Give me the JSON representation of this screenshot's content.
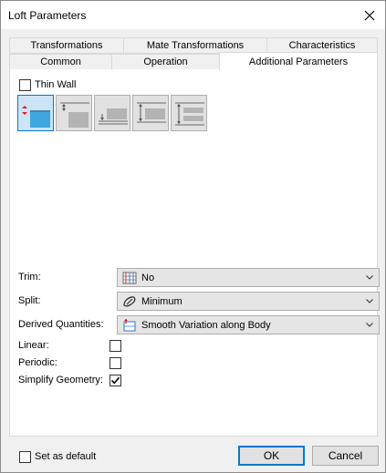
{
  "window": {
    "title": "Loft Parameters"
  },
  "tabs": {
    "row1": [
      "Transformations",
      "Mate Transformations",
      "Characteristics"
    ],
    "row2": [
      "Common",
      "Operation",
      "Additional Parameters"
    ],
    "active": "Additional Parameters"
  },
  "thin_wall": {
    "label": "Thin Wall",
    "checked": false
  },
  "wall_modes": [
    {
      "name": "outside-mode",
      "active": true
    },
    {
      "name": "inside-mode",
      "active": false
    },
    {
      "name": "two-sides-mode",
      "active": false
    },
    {
      "name": "symmetric-mode",
      "active": false
    },
    {
      "name": "middle-mode",
      "active": false
    }
  ],
  "fields": {
    "trim": {
      "label": "Trim:",
      "value": "No",
      "icon": "trim-icon"
    },
    "split": {
      "label": "Split:",
      "value": "Minimum",
      "icon": "split-icon"
    },
    "derived": {
      "label": "Derived Quantities:",
      "value": "Smooth Variation along Body",
      "icon": "derived-icon"
    },
    "linear": {
      "label": "Linear:",
      "checked": false
    },
    "periodic": {
      "label": "Periodic:",
      "checked": false
    },
    "simplify": {
      "label": "Simplify Geometry:",
      "checked": true
    }
  },
  "footer": {
    "set_default_label": "Set as default",
    "set_default_checked": false,
    "ok_label": "OK",
    "cancel_label": "Cancel"
  },
  "colors": {
    "accent": "#0078d7",
    "mode_fill": "#3fa6e0",
    "mode_gray": "#b3b3b3",
    "red_marker": "#e01b24"
  }
}
